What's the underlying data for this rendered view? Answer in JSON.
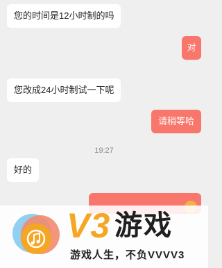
{
  "messages": [
    {
      "side": "in",
      "text": "您的时间是12小时制的吗"
    },
    {
      "side": "out",
      "text": "对"
    },
    {
      "side": "in",
      "text": "您改成24小时制试一下呢"
    },
    {
      "side": "out",
      "text": "请稍等哈"
    },
    {
      "side": "in",
      "text": "好的"
    }
  ],
  "timestamp": "19:27",
  "watermark": {
    "brand_latin": "V3",
    "brand_cn": "游戏",
    "slogan": "游戏人生，不负VVVV3"
  },
  "colors": {
    "outgoing_bubble": "#f8766b",
    "incoming_bubble": "#ffffff",
    "background": "#efefef",
    "brand_orange": "#f5a623"
  },
  "icons": [
    "music-note-logo-icon",
    "smile-emoji-icon"
  ]
}
